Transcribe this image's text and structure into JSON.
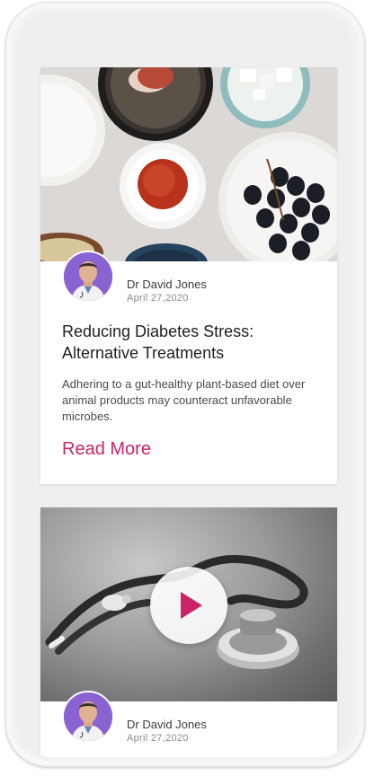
{
  "colors": {
    "accent": "#cc2368",
    "avatar_bg": "#8a63d2"
  },
  "posts": [
    {
      "author": "Dr David Jones",
      "date": "April  27,2020",
      "title": "Reducing Diabetes Stress: Alternative Treatments",
      "excerpt": "Adhering to a gut-healthy plant-based diet over animal products may counteract unfavorable microbes.",
      "read_more": "Read More",
      "image_icon": "food-bowls-photo"
    },
    {
      "author": "Dr David Jones",
      "date": "April  27,2020",
      "image_icon": "stethoscope-photo",
      "video_icon": "play-icon"
    }
  ]
}
